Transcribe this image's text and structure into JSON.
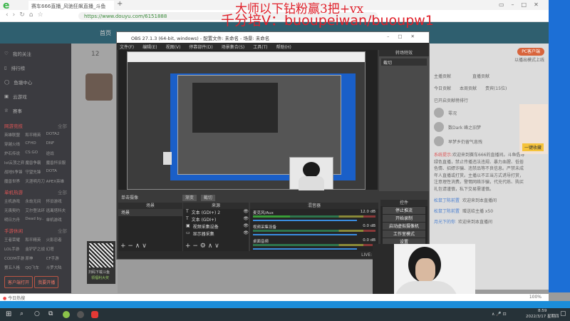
{
  "browser": {
    "tab_title": "赛车666直播_风驰狂飙直播_斗鱼",
    "url": "https://www.douyu.com/6151888"
  },
  "overlay": {
    "line1": "大师以下钻粉赢3把+vx",
    "line2": "千分培V：buoupeiwan/buoupw1"
  },
  "douyu": {
    "home": "首页",
    "count": "12"
  },
  "sidebar": {
    "items": [
      "我的关注",
      "排行榜",
      "鱼塘中心",
      "云游戏",
      "赛事"
    ],
    "sections": [
      {
        "title": "网游竞技",
        "more": "全部",
        "games": [
          "英雄联盟",
          "和平精英",
          "DOTA2",
          "穿越火线",
          "CFHD",
          "DNF",
          "炉石传说",
          "CS:GO",
          "逆战",
          "lol云顶之弈",
          "魔兽争霸",
          "魔兽怀旧服",
          "战地5争锋",
          "守望先锋",
          "DOTA",
          "魔兽世界",
          "天涯明月刀",
          "APEX英雄"
        ]
      },
      {
        "title": "单机热游",
        "more": "全部",
        "games": [
          "主机游戏",
          "永劫无间",
          "怀旧游戏",
          "无畏契约",
          "艾尔登法环",
          "逃离塔科夫",
          "明日方舟",
          "Dead by..",
          "单机游戏"
        ]
      },
      {
        "title": "手游休闲",
        "more": "全部",
        "games": [
          "王者荣耀",
          "和平精英",
          "火影忍者",
          "LOL手游",
          "金铲铲之战",
          "幻塔",
          "CODM手游",
          "原神",
          "CF手游",
          "第五人格",
          "QQ飞车",
          "斗罗大陆"
        ]
      }
    ],
    "btn_download": "客户端打开",
    "btn_live": "我要开播"
  },
  "qr": {
    "line1": "扫码下载斗鱼",
    "line2": "领福利大奖"
  },
  "obs": {
    "title": "OBS 27.1.3 (64-bit, windows) - 配置文件: 未命名 - 场景: 未命名",
    "menu": [
      "文件(F)",
      "编辑(E)",
      "视图(V)",
      "停靠部件(D)",
      "场景集合(S)",
      "工具(T)",
      "帮助(H)"
    ],
    "transition_title": "转场特效",
    "transition_value": "截切",
    "mode_label": "单击摄像",
    "btn_fade": "渐变",
    "btn_cut": "截切",
    "scenes_title": "场景",
    "scenes": [
      "场景"
    ],
    "sources_title": "来源",
    "sources": [
      {
        "icon": "T",
        "name": "文本 (GDI+) 2"
      },
      {
        "icon": "T",
        "name": "文本 (GDI+)"
      },
      {
        "icon": "▣",
        "name": "视频采集设备"
      },
      {
        "icon": "▭",
        "name": "显示器采集"
      }
    ],
    "mixer_title": "混音器",
    "mixer": [
      {
        "name": "麦克风/Aux",
        "db": "12.0 dB",
        "level": 0.3
      },
      {
        "name": "视频采集设备",
        "db": "0.0 dB",
        "level": 0
      },
      {
        "name": "桌面音频",
        "db": "0.0 dB",
        "level": 0
      }
    ],
    "controls_title": "控件",
    "controls": [
      "停止推流",
      "开始录制",
      "启动虚拟摄像机",
      "工作室模式",
      "设置"
    ],
    "status": "LIVE: 00:00:00   REC: 00:00:00"
  },
  "chat": {
    "pc_btn": "PC客户端",
    "pc_sub": "以播出模式上线",
    "tab_contrib": "主播贡献",
    "tab_fans": "直播贡献",
    "tabs": [
      "今日贡献",
      "本周贡献",
      "贵宾(15位)"
    ],
    "rank_title": "已开启贡献榜排行",
    "ranks": [
      "零况",
      "数Dark 峰之旧梦",
      "早梦乡仍留气息残"
    ],
    "sys_label": "系统提示:",
    "sys_msg": "欢迎来到赛车666的直播间。斗鱼倡导绿色直播，禁止传播违法违规、暴力血腥、低俗色情、招嫖诈骗、违禁品等不良信息。严禁未成年人直播或打赏。主播以不正当方式诱导打赏，注意理性消费。警惕网络诈骗，代充代练、购买礼包请谨慎，私下交易需谨慎。",
    "messages": [
      {
        "user": "松鼠丁陈前置",
        "text": "欢迎来到本直播间"
      },
      {
        "user": "松鼠丁陈前置",
        "text": "赠送给主播 x50"
      },
      {
        "user": "月光下的你",
        "text": "欢迎来到本直播间"
      }
    ],
    "promo": "一键收藏"
  },
  "bottom_bar": {
    "hot": "今日热搜",
    "zoom": "100%"
  },
  "taskbar": {
    "time": "8:59",
    "date": "2022/3/17 星期四"
  }
}
